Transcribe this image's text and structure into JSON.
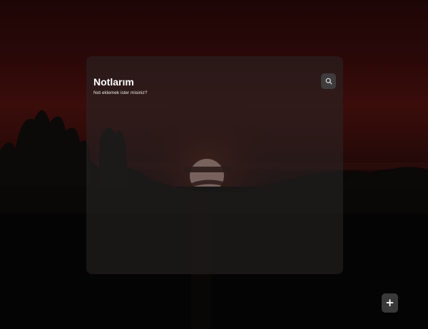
{
  "notes": {
    "title": "Notlarım",
    "subtitle": "Not eklemek ister misiniz?",
    "search_icon": "search-icon",
    "add_icon": "plus-icon",
    "add_symbol": "+"
  },
  "colors": {
    "panel_bg": "#2a2626",
    "button_bg": "#3e3c3c",
    "text": "#ffffff"
  }
}
